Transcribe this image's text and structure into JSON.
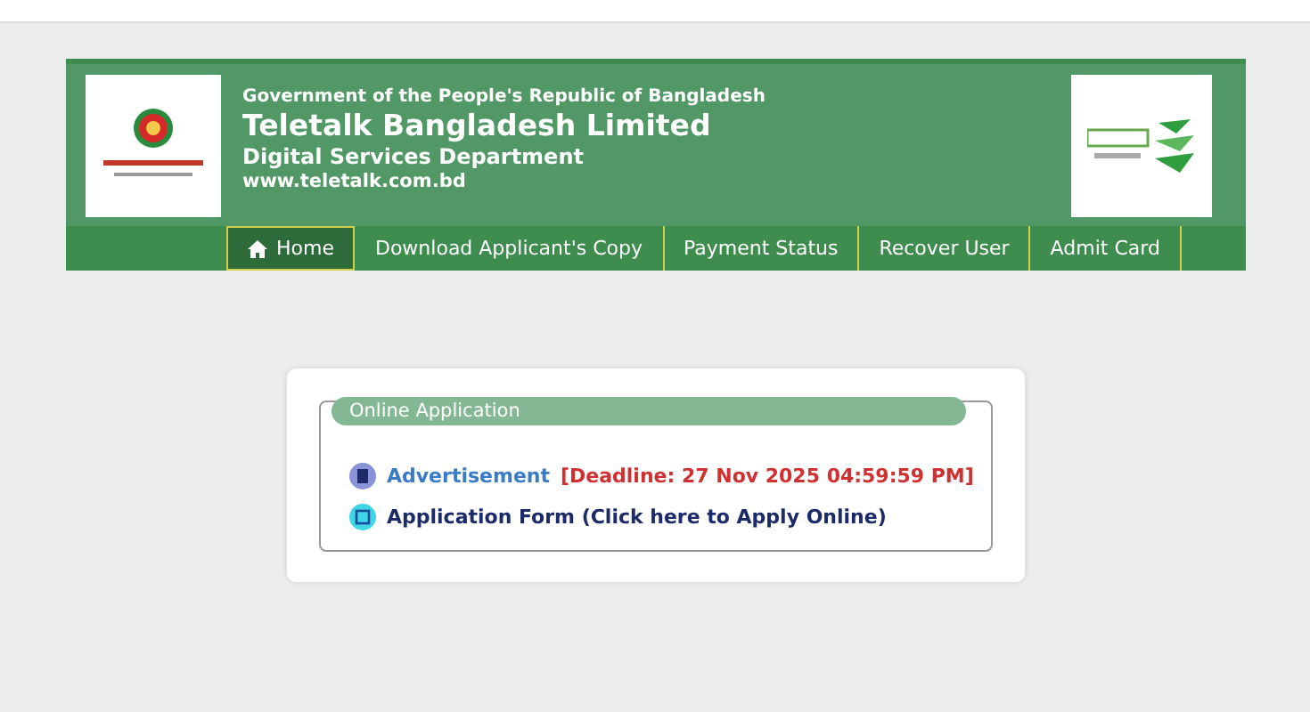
{
  "header": {
    "government": "Government of the People's Republic of Bangladesh",
    "organization": "Teletalk Bangladesh Limited",
    "department": "Digital Services Department",
    "website": "www.teletalk.com.bd"
  },
  "nav": [
    {
      "kind": "home",
      "label": "Home",
      "selected": true
    },
    {
      "kind": "link",
      "label": "Download Applicant's Copy",
      "selected": false
    },
    {
      "kind": "link",
      "label": "Payment Status",
      "selected": false
    },
    {
      "kind": "link",
      "label": "Recover User",
      "selected": false
    },
    {
      "kind": "link",
      "label": "Admit Card",
      "selected": false
    }
  ],
  "application_box": {
    "legend": "Online Application",
    "links": [
      {
        "kind": "advertisement",
        "label": "Advertisement",
        "note": "[Deadline: 27 Nov 2025 04:59:59 PM]"
      },
      {
        "kind": "form",
        "label": "Application Form (Click here to Apply Online)"
      }
    ]
  }
}
